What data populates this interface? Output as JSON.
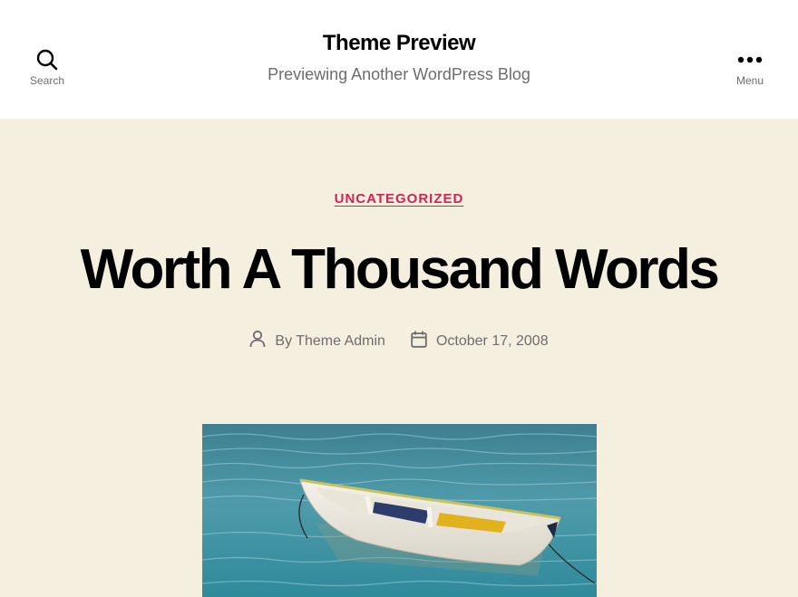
{
  "header": {
    "search_label": "Search",
    "menu_label": "Menu",
    "site_title": "Theme Preview",
    "site_description": "Previewing Another WordPress Blog"
  },
  "post": {
    "category": "UNCATEGORIZED",
    "title": "Worth A Thousand Words",
    "author_text": "By Theme Admin",
    "date": "October 17, 2008"
  },
  "colors": {
    "accent": "#cd2653",
    "background": "#f5efe0",
    "header_background": "#ffffff",
    "secondary_text": "#6d6d6d"
  },
  "icons": {
    "search": "search-icon",
    "menu": "ellipsis-icon",
    "author": "user-icon",
    "date": "calendar-icon"
  },
  "image": {
    "subject": "boat-on-water-photo"
  }
}
